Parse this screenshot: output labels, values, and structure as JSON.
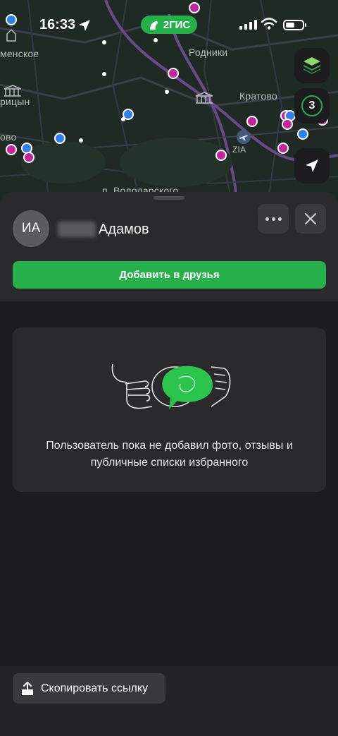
{
  "status_bar": {
    "time": "16:33",
    "app_pill": "2ГИС"
  },
  "map": {
    "labels": [
      "Родники",
      "Кратово",
      "ZIA",
      "менское",
      "рицын",
      "ово",
      "п. Володарского"
    ],
    "pin_colors": {
      "pink": "#c2259c",
      "blue": "#2f7ff0"
    }
  },
  "map_controls": {
    "layers_icon": "layers-icon",
    "counter": "3",
    "locate_icon": "navigation-arrow-icon"
  },
  "profile": {
    "initials": "ИА",
    "last_name": "Адамов",
    "add_friend_label": "Добавить в друзья"
  },
  "empty_state": {
    "message": "Пользователь пока не добавил фото, отзывы и публичные списки избранного"
  },
  "footer": {
    "copy_link_label": "Скопировать ссылку"
  },
  "colors": {
    "accent": "#26b04a",
    "background": "#1c1c1e",
    "card": "#2a2a2c"
  }
}
